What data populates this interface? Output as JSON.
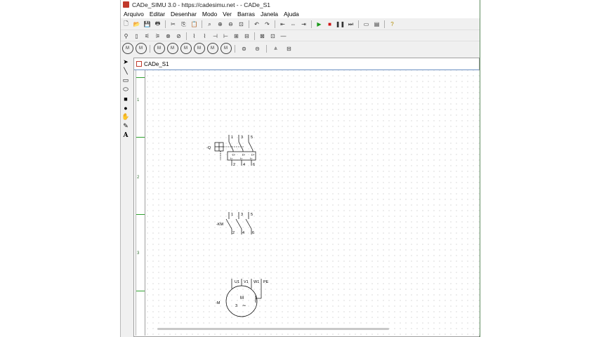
{
  "window": {
    "title": "CADe_SIMU 3.0 - https://cadesimu.net - - CADe_S1"
  },
  "menu": [
    "Arquivo",
    "Editar",
    "Desenhar",
    "Modo",
    "Ver",
    "Barras",
    "Janela",
    "Ajuda"
  ],
  "toolbar1": [
    {
      "name": "new-file-icon",
      "glyph": "🗋"
    },
    {
      "name": "open-folder-icon",
      "glyph": "📂"
    },
    {
      "name": "save-icon",
      "glyph": "💾"
    },
    {
      "name": "print-icon",
      "glyph": "🖶"
    },
    {
      "name": "cut-icon",
      "glyph": "✂"
    },
    {
      "name": "copy-icon",
      "glyph": "⎘"
    },
    {
      "name": "paste-icon",
      "glyph": "📋"
    },
    {
      "name": "zoom-icon",
      "glyph": "⌕"
    },
    {
      "name": "zoom-in-icon",
      "glyph": "⊕"
    },
    {
      "name": "zoom-out-icon",
      "glyph": "⊖"
    },
    {
      "name": "zoom-fit-icon",
      "glyph": "⊡"
    },
    {
      "name": "undo-icon",
      "glyph": "↶"
    },
    {
      "name": "redo-icon",
      "glyph": "↷"
    },
    {
      "name": "align-left-icon",
      "glyph": "⇤"
    },
    {
      "name": "align-center-icon",
      "glyph": "⇔"
    },
    {
      "name": "align-right-icon",
      "glyph": "⇥"
    },
    {
      "name": "play-icon",
      "glyph": "▶"
    },
    {
      "name": "stop-icon",
      "glyph": "■"
    },
    {
      "name": "pause-icon",
      "glyph": "❚❚"
    },
    {
      "name": "step-icon",
      "glyph": "⏭"
    },
    {
      "name": "window-icon",
      "glyph": "▭"
    },
    {
      "name": "window-list-icon",
      "glyph": "▤"
    },
    {
      "name": "help-icon",
      "glyph": "?"
    }
  ],
  "toolbar2": [
    "⚲",
    "▯",
    "⚟",
    "⚞",
    "⊗",
    "⊘",
    "⌇",
    "⌇",
    "⊣",
    "⊢",
    "⊞",
    "⊟",
    "⊠",
    "⊡",
    "—"
  ],
  "toolbar3": [
    "M",
    "M",
    "M",
    "M",
    "M",
    "M",
    "M",
    "M",
    "⊜",
    "⊝",
    "⩓",
    "⊟"
  ],
  "lefttools": [
    {
      "name": "select-arrow-icon",
      "glyph": "➤"
    },
    {
      "name": "line-tool-icon",
      "glyph": "╲"
    },
    {
      "name": "rectangle-tool-icon",
      "glyph": "▭"
    },
    {
      "name": "rounded-rect-tool-icon",
      "glyph": "⬭"
    },
    {
      "name": "filled-rect-tool-icon",
      "glyph": "■"
    },
    {
      "name": "circle-tool-icon",
      "glyph": "●"
    },
    {
      "name": "fill-tool-icon",
      "glyph": "✋"
    },
    {
      "name": "pen-tool-icon",
      "glyph": "✎"
    },
    {
      "name": "text-tool-icon",
      "glyph": "A"
    }
  ],
  "document": {
    "title": "CADe_S1"
  },
  "ruler_labels": [
    "1",
    "2",
    "3"
  ],
  "components": {
    "q_label": "-Q",
    "q_top": [
      "1",
      "3",
      "5"
    ],
    "q_bottom": [
      "2",
      "4",
      "6"
    ],
    "km_label": "-KM",
    "km_top": [
      "1",
      "3",
      "5"
    ],
    "km_bottom": [
      "2",
      "4",
      "6"
    ],
    "m_label": "-M",
    "m_terminals": [
      "U1",
      "V1",
      "W1",
      "PE"
    ],
    "m_text": "M",
    "m_phase": "3",
    "m_ac": "~"
  }
}
